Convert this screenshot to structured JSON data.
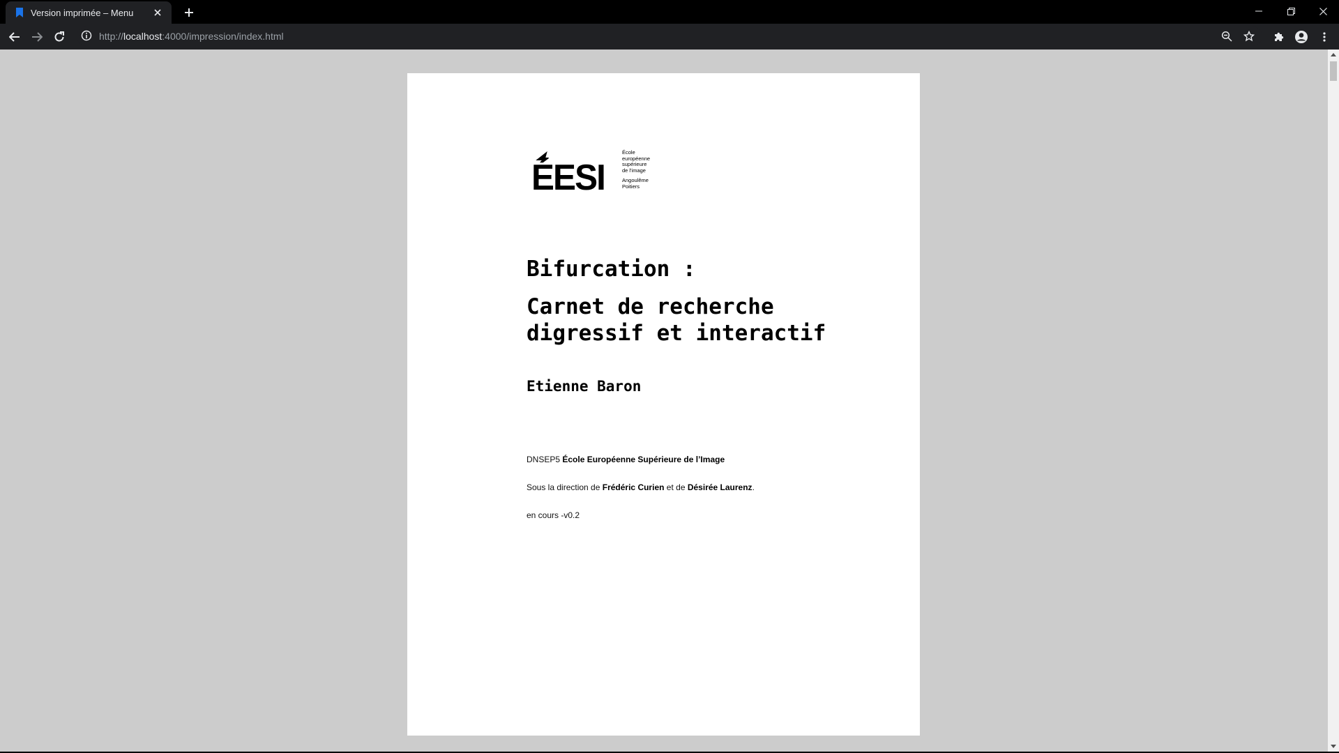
{
  "browser": {
    "tab_title": "Version imprimée – Menu",
    "url_scheme": "http://",
    "url_host": "localhost",
    "url_path": ":4000/impression/index.html",
    "accent_color": "#1a73e8"
  },
  "icons": {
    "favicon": "bookmark-icon",
    "tab_close": "close-icon",
    "new_tab": "plus-icon",
    "back": "arrow-left-icon",
    "forward": "arrow-right-icon",
    "reload": "reload-icon",
    "site_info": "info-icon",
    "zoom": "zoom-icon",
    "bookmark": "star-icon",
    "extensions": "puzzle-icon",
    "profile": "profile-icon",
    "menu": "kebab-menu-icon"
  },
  "logo": {
    "wordmark": "ÉESI",
    "lines": [
      "École",
      "européenne",
      "supérieure",
      "de l'image"
    ],
    "location_lines": [
      "Angoulême",
      "Poitiers"
    ]
  },
  "document": {
    "title": "Bifurcation :",
    "subtitle": "Carnet de recherche digressif et interactif",
    "author": "Etienne Baron",
    "degree_prefix": "DNSEP5",
    "school": "École Européenne Supérieure de l’Image",
    "direction_prefix": "Sous la direction de",
    "director_1": "Frédéric Curien",
    "direction_and": "et de",
    "director_2": "Désirée Laurenz",
    "direction_suffix": ".",
    "status": "en cours -v0.2"
  }
}
